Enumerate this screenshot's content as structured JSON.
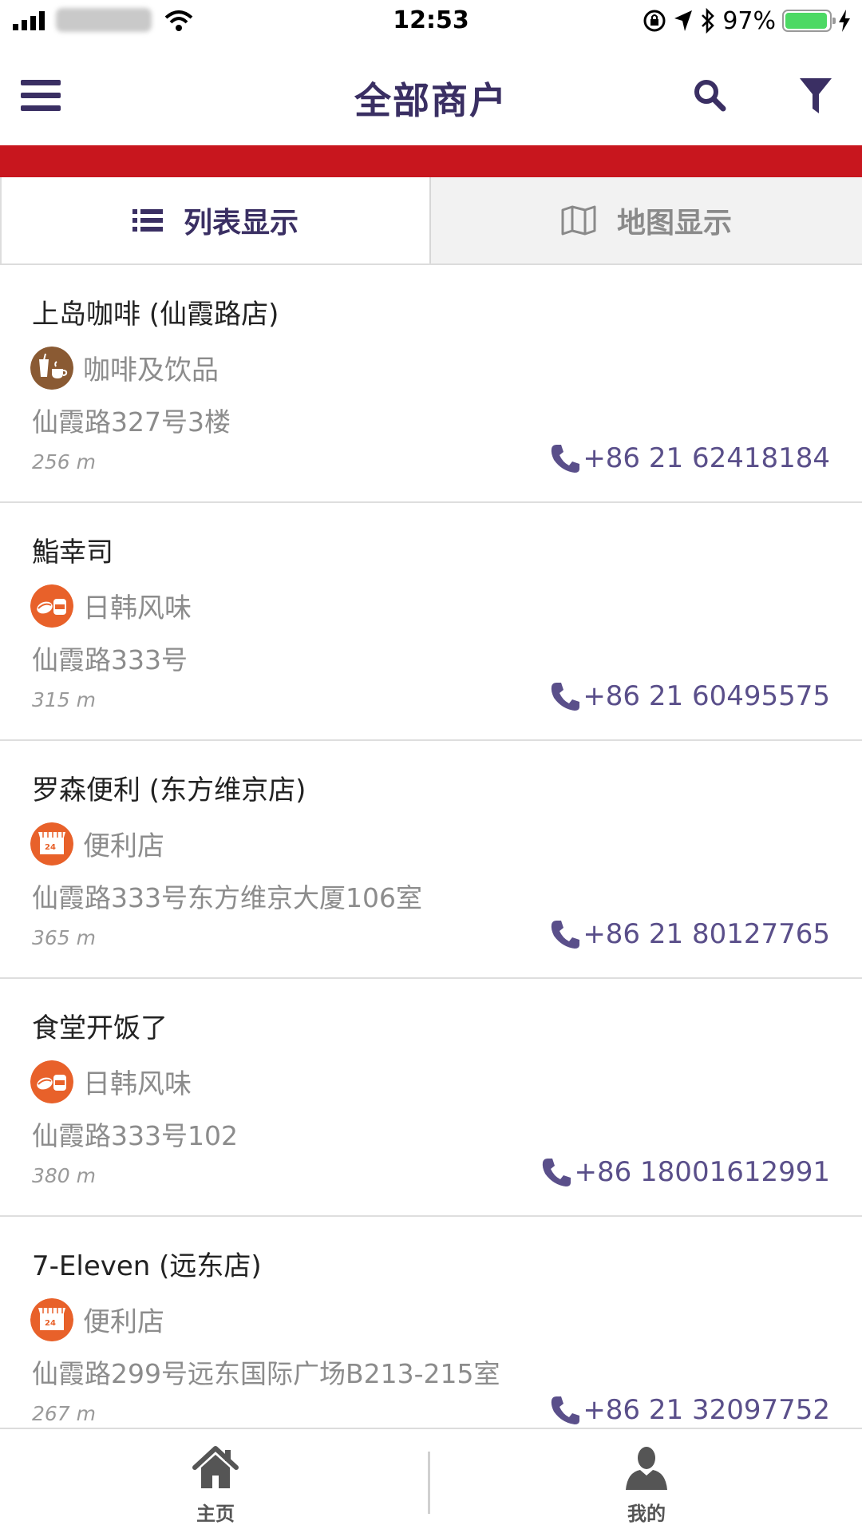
{
  "status": {
    "time": "12:53",
    "battery": "97%",
    "battery_level": 0.97
  },
  "nav": {
    "title": "全部商户"
  },
  "tabs": {
    "list": "列表显示",
    "map": "地图显示"
  },
  "items": [
    {
      "name": "上岛咖啡 (仙霞路店)",
      "category": "咖啡及饮品",
      "address": "仙霞路327号3楼",
      "distance": "256 m",
      "phone": "+86 21 62418184",
      "icon": "coffee-icon",
      "color": "#8a5a33"
    },
    {
      "name": "鮨幸司",
      "category": "日韩风味",
      "address": "仙霞路333号",
      "distance": "315 m",
      "phone": "+86 21 60495575",
      "icon": "sushi-icon",
      "color": "#e8612a"
    },
    {
      "name": "罗森便利 (东方维京店)",
      "category": "便利店",
      "address": "仙霞路333号东方维京大厦106室",
      "distance": "365 m",
      "phone": "+86 21 80127765",
      "icon": "store-icon",
      "color": "#e8612a"
    },
    {
      "name": "食堂开饭了",
      "category": "日韩风味",
      "address": "仙霞路333号102",
      "distance": "380 m",
      "phone": "+86 18001612991",
      "icon": "sushi-icon",
      "color": "#e8612a"
    },
    {
      "name": "7-Eleven (远东店)",
      "category": "便利店",
      "address": "仙霞路299号远东国际广场B213-215室",
      "distance": "267 m",
      "phone": "+86 21 32097752",
      "icon": "store-icon",
      "color": "#e8612a"
    }
  ],
  "tabbar": {
    "home": "主页",
    "me": "我的"
  },
  "colors": {
    "accent": "#3a2f63",
    "band": "#c8161e",
    "phone": "#5a4f8a"
  }
}
